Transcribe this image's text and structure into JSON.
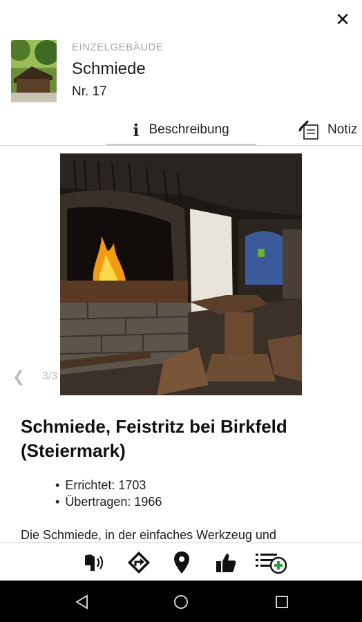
{
  "header": {
    "category": "EINZELGEBÄUDE",
    "title": "Schmiede",
    "number": "Nr. 17",
    "close_icon": "close-icon"
  },
  "tabs": [
    {
      "label": "Beschreibung",
      "icon": "info-icon",
      "active": true
    },
    {
      "label": "Notiz",
      "icon": "note-edit-icon",
      "active": false
    }
  ],
  "gallery": {
    "counter": "3/3",
    "prev_icon": "chevron-left-icon"
  },
  "content": {
    "heading": "Schmiede, Feistritz bei Birkfeld (Steiermark)",
    "facts": [
      "Errichtet: 1703",
      "Übertragen: 1966"
    ],
    "body": "Die Schmiede, in der einfaches Werkzeug und"
  },
  "bottom_bar": {
    "icons": [
      "audio-guide-icon",
      "directions-icon",
      "location-pin-icon",
      "thumbs-up-icon",
      "add-to-list-icon"
    ],
    "accent": "#2e9e3a"
  },
  "android_nav": {
    "icons": [
      "back-icon",
      "home-icon",
      "recents-icon"
    ]
  }
}
